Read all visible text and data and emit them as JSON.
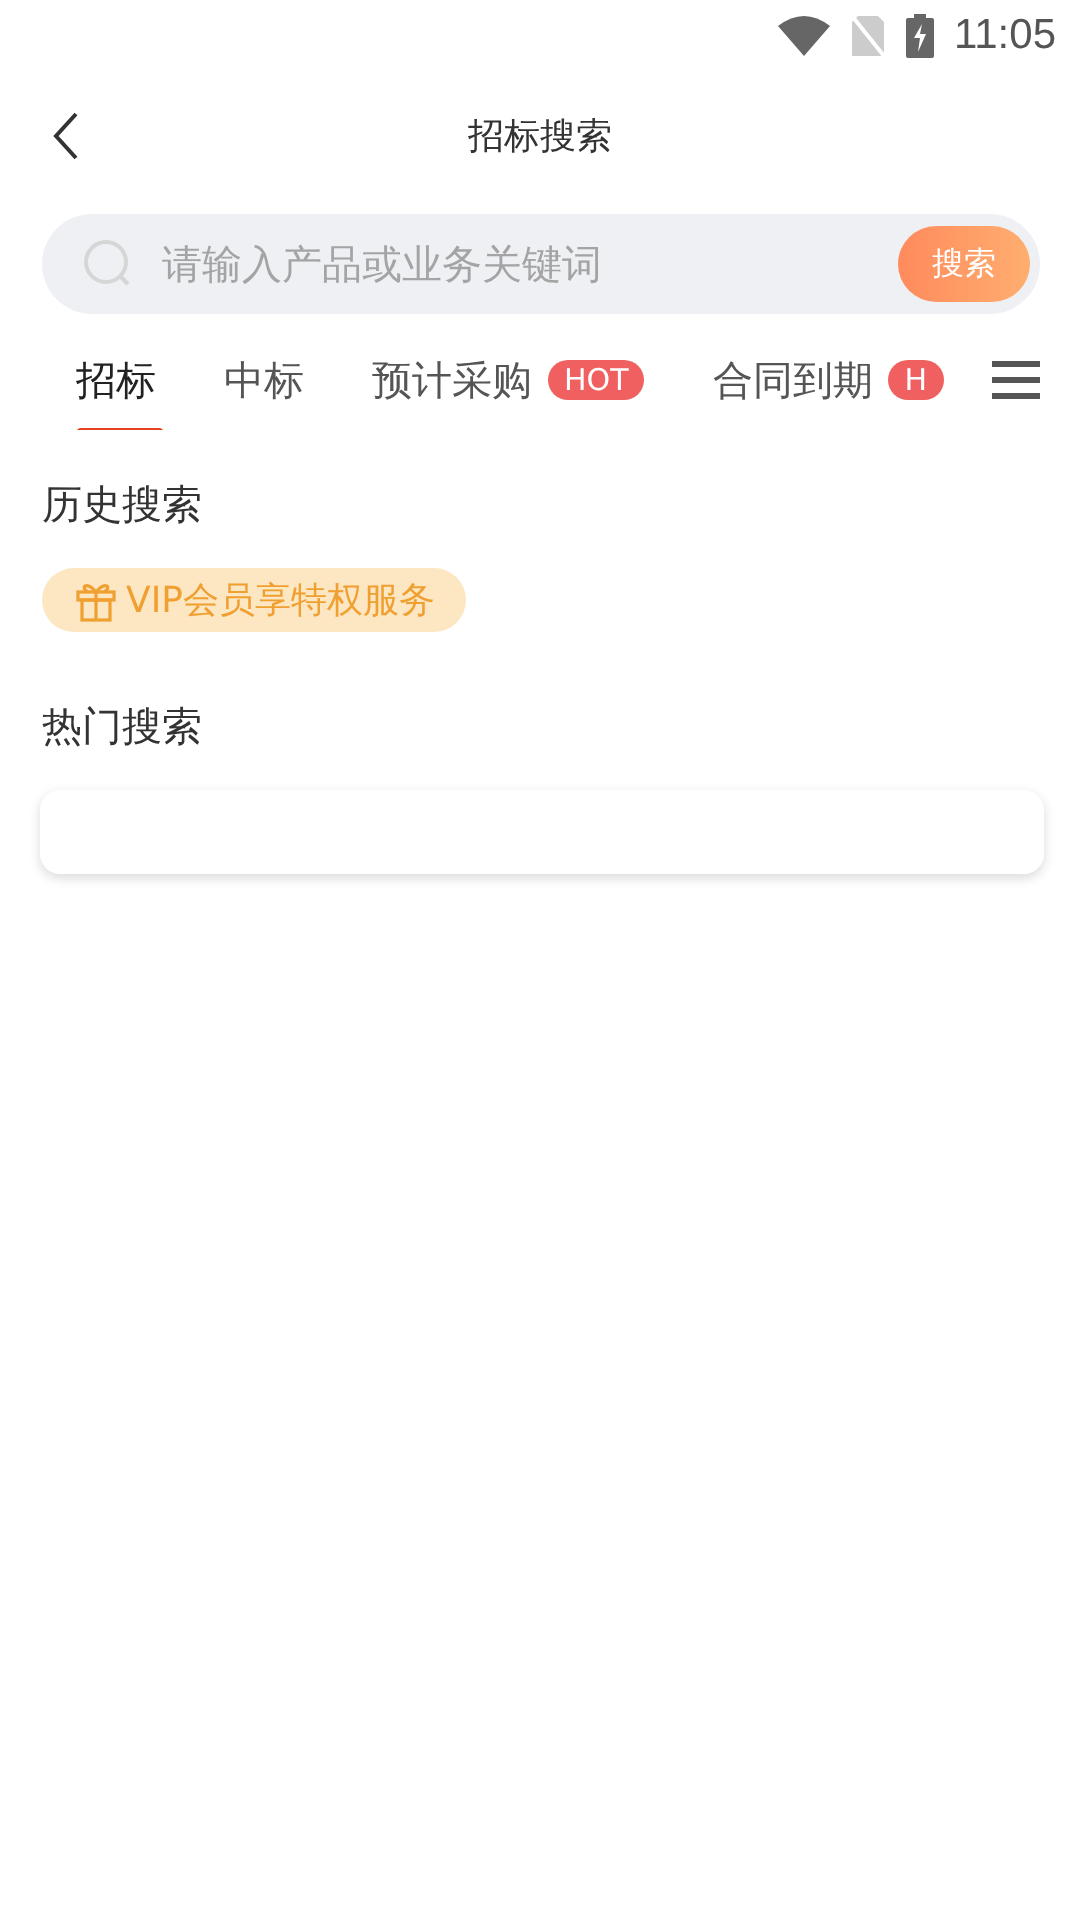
{
  "status_bar": {
    "time": "11:05"
  },
  "header": {
    "title": "招标搜索"
  },
  "search": {
    "placeholder": "请输入产品或业务关键词",
    "button": "搜索"
  },
  "tabs": [
    {
      "label": "招标",
      "selected": true
    },
    {
      "label": "中标",
      "selected": false
    },
    {
      "label": "预计采购",
      "selected": false,
      "badge": "HOT"
    },
    {
      "label": "合同到期",
      "selected": false,
      "badge": "H"
    }
  ],
  "history": {
    "title": "历史搜索",
    "vip_tag": "VIP会员享特权服务"
  },
  "hot": {
    "title": "热门搜索"
  }
}
